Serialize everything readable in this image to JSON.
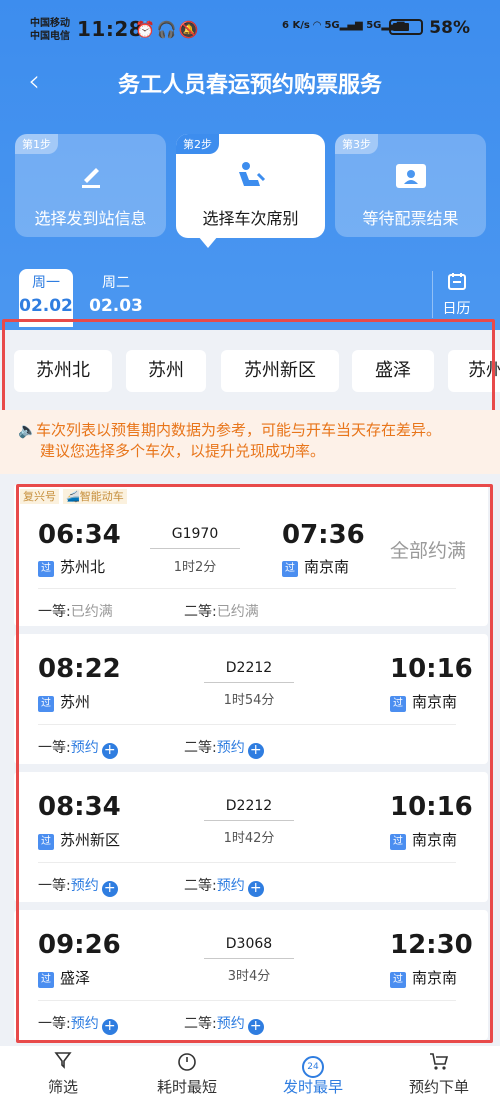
{
  "status": {
    "carrier1": "中国移动",
    "carrier2": "中国电信",
    "time": "11:28",
    "battery": "58%",
    "speed": "6 K/s",
    "net1": "5G",
    "net2": "5G"
  },
  "header": {
    "title": "务工人员春运预约购票服务"
  },
  "steps": [
    {
      "tag": "第1步",
      "label": "选择发到站信息"
    },
    {
      "tag": "第2步",
      "label": "选择车次席别"
    },
    {
      "tag": "第3步",
      "label": "等待配票结果"
    }
  ],
  "dates": [
    {
      "weekday": "周一",
      "date": "02.02"
    },
    {
      "weekday": "周二",
      "date": "02.03"
    }
  ],
  "calendar_label": "日历",
  "stations": [
    "苏州北",
    "苏州",
    "苏州新区",
    "盛泽",
    "苏州"
  ],
  "notice": {
    "line1": "车次列表以预售期内数据为参考，可能与开车当天存在差异。",
    "line2": "建议您选择多个车次，以提升兑现成功率。"
  },
  "trains": [
    {
      "badge1": "复兴号",
      "badge2": "智能动车",
      "dep_time": "06:34",
      "dep_station": "苏州北",
      "guo": "过",
      "train_no": "G1970",
      "duration": "1时2分",
      "arr_time": "07:36",
      "arr_station": "南京南",
      "status": "全部约满",
      "first_label": "一等:",
      "first_value": "已约满",
      "second_label": "二等:",
      "second_value": "已约满"
    },
    {
      "dep_time": "08:22",
      "dep_station": "苏州",
      "guo": "过",
      "train_no": "D2212",
      "duration": "1时54分",
      "arr_time": "10:16",
      "arr_station": "南京南",
      "first_label": "一等:",
      "first_value": "预约",
      "second_label": "二等:",
      "second_value": "预约"
    },
    {
      "dep_time": "08:34",
      "dep_station": "苏州新区",
      "guo": "过",
      "train_no": "D2212",
      "duration": "1时42分",
      "arr_time": "10:16",
      "arr_station": "南京南",
      "first_label": "一等:",
      "first_value": "预约",
      "second_label": "二等:",
      "second_value": "预约"
    },
    {
      "dep_time": "09:26",
      "dep_station": "盛泽",
      "guo": "过",
      "train_no": "D3068",
      "duration": "3时4分",
      "arr_time": "12:30",
      "arr_station": "南京南",
      "first_label": "一等:",
      "first_value": "预约",
      "second_label": "二等:",
      "second_value": "预约"
    }
  ],
  "tabs": [
    {
      "label": "筛选"
    },
    {
      "label": "耗时最短"
    },
    {
      "label": "发时最早",
      "badge": "24"
    },
    {
      "label": "预约下单"
    }
  ],
  "colors": {
    "primary": "#3d8dee",
    "accent": "#2f7de0",
    "warning": "#e8751a",
    "highlight": "#e84a4a"
  }
}
